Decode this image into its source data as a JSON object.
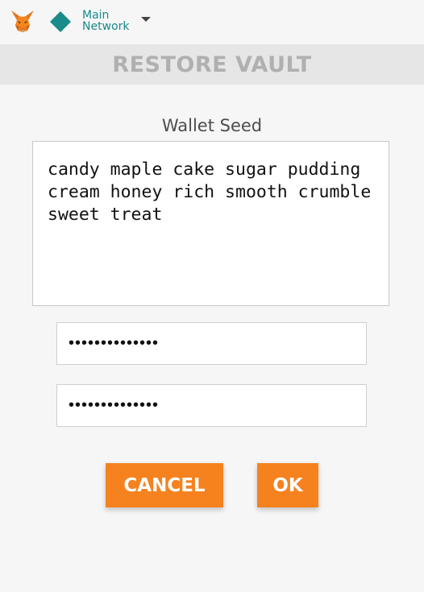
{
  "header": {
    "network_line1": "Main",
    "network_line2": "Network",
    "network_color": "#1a8a8a",
    "logo_icon": "metamask-fox-icon",
    "network_icon": "diamond-icon",
    "dropdown_icon": "caret-down-icon"
  },
  "page": {
    "title": "RESTORE VAULT"
  },
  "form": {
    "seed_label": "Wallet Seed",
    "seed_value": "candy maple cake sugar pudding cream honey rich smooth crumble sweet treat",
    "password_value": "**************",
    "confirm_password_value": "**************"
  },
  "buttons": {
    "cancel_label": "CANCEL",
    "ok_label": "OK",
    "accent_color": "#f5821f"
  }
}
